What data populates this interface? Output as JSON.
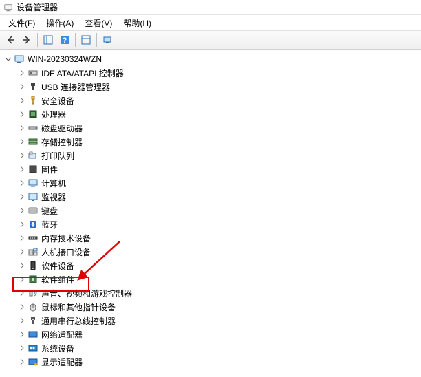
{
  "window": {
    "title": "设备管理器"
  },
  "menu": {
    "file": "文件(F)",
    "action": "操作(A)",
    "view": "查看(V)",
    "help": "帮助(H)"
  },
  "root": {
    "label": "WIN-20230324WZN"
  },
  "categories": [
    {
      "label": "IDE ATA/ATAPI 控制器"
    },
    {
      "label": "USB 连接器管理器"
    },
    {
      "label": "安全设备"
    },
    {
      "label": "处理器"
    },
    {
      "label": "磁盘驱动器"
    },
    {
      "label": "存储控制器"
    },
    {
      "label": "打印队列"
    },
    {
      "label": "固件"
    },
    {
      "label": "计算机"
    },
    {
      "label": "监视器"
    },
    {
      "label": "键盘"
    },
    {
      "label": "蓝牙"
    },
    {
      "label": "内存技术设备"
    },
    {
      "label": "人机接口设备"
    },
    {
      "label": "软件设备"
    },
    {
      "label": "软件组件"
    },
    {
      "label": "声音、视频和游戏控制器"
    },
    {
      "label": "鼠标和其他指针设备"
    },
    {
      "label": "通用串行总线控制器"
    },
    {
      "label": "网络适配器"
    },
    {
      "label": "系统设备"
    },
    {
      "label": "显示适配器"
    }
  ]
}
